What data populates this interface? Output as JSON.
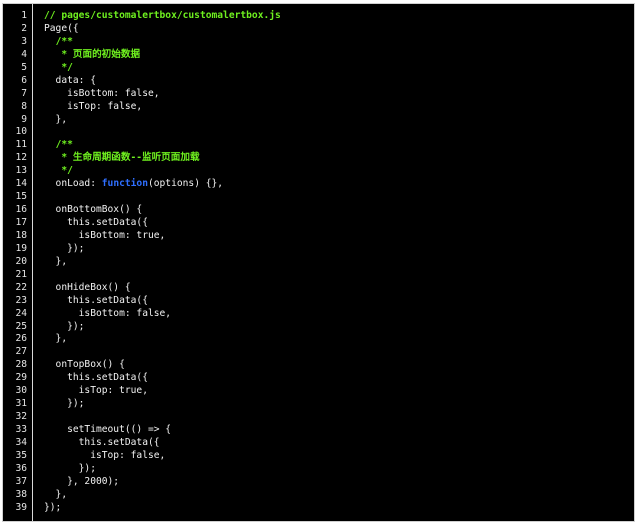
{
  "editor": {
    "colors": {
      "background": "#000000",
      "text": "#f2f2f2",
      "comment": "#6ff01f",
      "keyword": "#2f6fff",
      "gutter_border": "#d9d9d9"
    },
    "lines": [
      {
        "num": "1",
        "tokens": [
          {
            "t": "// pages/customalertbox/customalertbox.js",
            "k": "comment"
          }
        ]
      },
      {
        "num": "2",
        "tokens": [
          {
            "t": "Page({",
            "k": "plain"
          }
        ]
      },
      {
        "num": "3",
        "tokens": [
          {
            "t": "  ",
            "k": "plain"
          },
          {
            "t": "/**",
            "k": "comment"
          }
        ]
      },
      {
        "num": "4",
        "tokens": [
          {
            "t": "   * 页面的初始数据",
            "k": "comment"
          }
        ]
      },
      {
        "num": "5",
        "tokens": [
          {
            "t": "   */",
            "k": "comment"
          }
        ]
      },
      {
        "num": "6",
        "tokens": [
          {
            "t": "  data: {",
            "k": "plain"
          }
        ]
      },
      {
        "num": "7",
        "tokens": [
          {
            "t": "    isBottom: false,",
            "k": "plain"
          }
        ]
      },
      {
        "num": "8",
        "tokens": [
          {
            "t": "    isTop: false,",
            "k": "plain"
          }
        ]
      },
      {
        "num": "9",
        "tokens": [
          {
            "t": "  },",
            "k": "plain"
          }
        ]
      },
      {
        "num": "10",
        "tokens": [
          {
            "t": "",
            "k": "plain"
          }
        ]
      },
      {
        "num": "11",
        "tokens": [
          {
            "t": "  ",
            "k": "plain"
          },
          {
            "t": "/**",
            "k": "comment"
          }
        ]
      },
      {
        "num": "12",
        "tokens": [
          {
            "t": "   * 生命周期函数--监听页面加载",
            "k": "comment"
          }
        ]
      },
      {
        "num": "13",
        "tokens": [
          {
            "t": "   */",
            "k": "comment"
          }
        ]
      },
      {
        "num": "14",
        "tokens": [
          {
            "t": "  onLoad: ",
            "k": "plain"
          },
          {
            "t": "function",
            "k": "keyword"
          },
          {
            "t": "(options) {},",
            "k": "plain"
          }
        ]
      },
      {
        "num": "15",
        "tokens": [
          {
            "t": "",
            "k": "plain"
          }
        ]
      },
      {
        "num": "16",
        "tokens": [
          {
            "t": "  onBottomBox() {",
            "k": "plain"
          }
        ]
      },
      {
        "num": "17",
        "tokens": [
          {
            "t": "    this.setData({",
            "k": "plain"
          }
        ]
      },
      {
        "num": "18",
        "tokens": [
          {
            "t": "      isBottom: true,",
            "k": "plain"
          }
        ]
      },
      {
        "num": "19",
        "tokens": [
          {
            "t": "    });",
            "k": "plain"
          }
        ]
      },
      {
        "num": "20",
        "tokens": [
          {
            "t": "  },",
            "k": "plain"
          }
        ]
      },
      {
        "num": "21",
        "tokens": [
          {
            "t": "",
            "k": "plain"
          }
        ]
      },
      {
        "num": "22",
        "tokens": [
          {
            "t": "  onHideBox() {",
            "k": "plain"
          }
        ]
      },
      {
        "num": "23",
        "tokens": [
          {
            "t": "    this.setData({",
            "k": "plain"
          }
        ]
      },
      {
        "num": "24",
        "tokens": [
          {
            "t": "      isBottom: false,",
            "k": "plain"
          }
        ]
      },
      {
        "num": "25",
        "tokens": [
          {
            "t": "    });",
            "k": "plain"
          }
        ]
      },
      {
        "num": "26",
        "tokens": [
          {
            "t": "  },",
            "k": "plain"
          }
        ]
      },
      {
        "num": "27",
        "tokens": [
          {
            "t": "",
            "k": "plain"
          }
        ]
      },
      {
        "num": "28",
        "tokens": [
          {
            "t": "  onTopBox() {",
            "k": "plain"
          }
        ]
      },
      {
        "num": "29",
        "tokens": [
          {
            "t": "    this.setData({",
            "k": "plain"
          }
        ]
      },
      {
        "num": "30",
        "tokens": [
          {
            "t": "      isTop: true,",
            "k": "plain"
          }
        ]
      },
      {
        "num": "31",
        "tokens": [
          {
            "t": "    });",
            "k": "plain"
          }
        ]
      },
      {
        "num": "32",
        "tokens": [
          {
            "t": "",
            "k": "plain"
          }
        ]
      },
      {
        "num": "33",
        "tokens": [
          {
            "t": "    setTimeout(() => {",
            "k": "plain"
          }
        ]
      },
      {
        "num": "34",
        "tokens": [
          {
            "t": "      this.setData({",
            "k": "plain"
          }
        ]
      },
      {
        "num": "35",
        "tokens": [
          {
            "t": "        isTop: false,",
            "k": "plain"
          }
        ]
      },
      {
        "num": "36",
        "tokens": [
          {
            "t": "      });",
            "k": "plain"
          }
        ]
      },
      {
        "num": "37",
        "tokens": [
          {
            "t": "    }, 2000);",
            "k": "plain"
          }
        ]
      },
      {
        "num": "38",
        "tokens": [
          {
            "t": "  },",
            "k": "plain"
          }
        ]
      },
      {
        "num": "39",
        "tokens": [
          {
            "t": "});",
            "k": "plain"
          }
        ]
      }
    ]
  }
}
